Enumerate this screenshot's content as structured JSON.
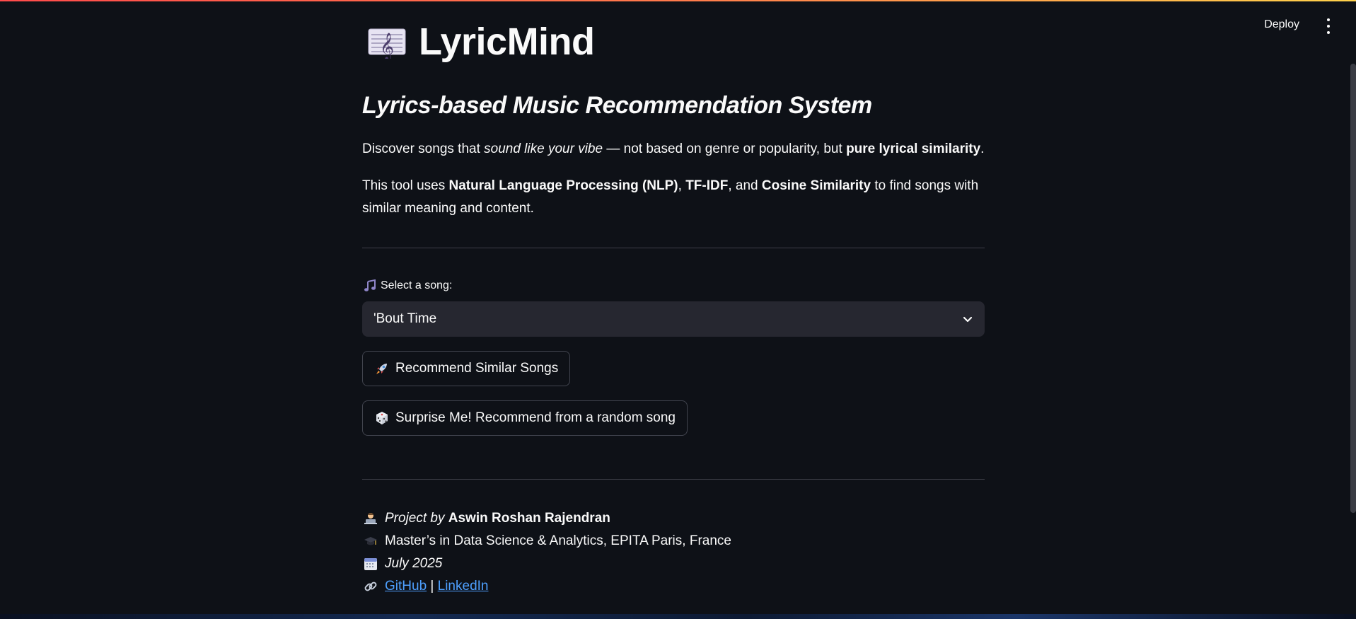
{
  "header": {
    "deploy_label": "Deploy"
  },
  "app": {
    "title": "LyricMind",
    "title_icon": "musical-score-icon",
    "subtitle": "Lyrics-based Music Recommendation System"
  },
  "intro": {
    "p1_a": "Discover songs that ",
    "p1_em": "sound like your vibe",
    "p1_b": " — not based on genre or popularity, but ",
    "p1_strong": "pure lyrical similarity",
    "p1_c": ".",
    "p2_a": "This tool uses ",
    "p2_s1": "Natural Language Processing (NLP)",
    "p2_b": ", ",
    "p2_s2": "TF-IDF",
    "p2_c": ", and ",
    "p2_s3": "Cosine Similarity",
    "p2_d": " to find songs with similar meaning and content."
  },
  "song_select": {
    "label": "Select a song:",
    "label_icon": "musical-notes-icon",
    "value": "'Bout Time"
  },
  "buttons": {
    "recommend_label": "Recommend Similar Songs",
    "recommend_icon": "rocket-icon",
    "surprise_label": "Surprise Me! Recommend from a random song",
    "surprise_icon": "dice-icon"
  },
  "footer": {
    "project_prefix": "Project by",
    "author": "Aswin Roshan Rajendran",
    "degree": "Master’s in Data Science & Analytics, EPITA Paris, France",
    "date": "July 2025",
    "github": "GitHub",
    "separator": "|",
    "linkedin": "LinkedIn"
  },
  "colors": {
    "background": "#0e1117",
    "select_bg": "#262730",
    "link": "#4ea0ff"
  }
}
